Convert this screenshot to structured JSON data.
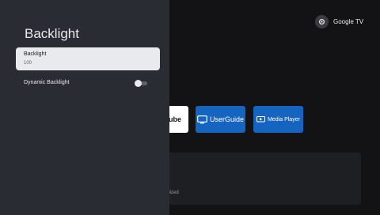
{
  "account": {
    "label": "Google TV",
    "icon": "gear-icon"
  },
  "apps": [
    {
      "label": "ube",
      "color": "#ffffff"
    },
    {
      "label": "UserGuide",
      "icon": "monitor-icon",
      "color": "#1565c0"
    },
    {
      "label": "Media Player",
      "icon": "media-player-icon",
      "color": "#1565c0"
    }
  ],
  "card": {
    "text": "olized"
  },
  "panel": {
    "title": "Backlight",
    "items": [
      {
        "label": "Backlight",
        "value": "100",
        "selected": true
      },
      {
        "label": "Dynamic Backlight",
        "toggle": false
      }
    ]
  }
}
